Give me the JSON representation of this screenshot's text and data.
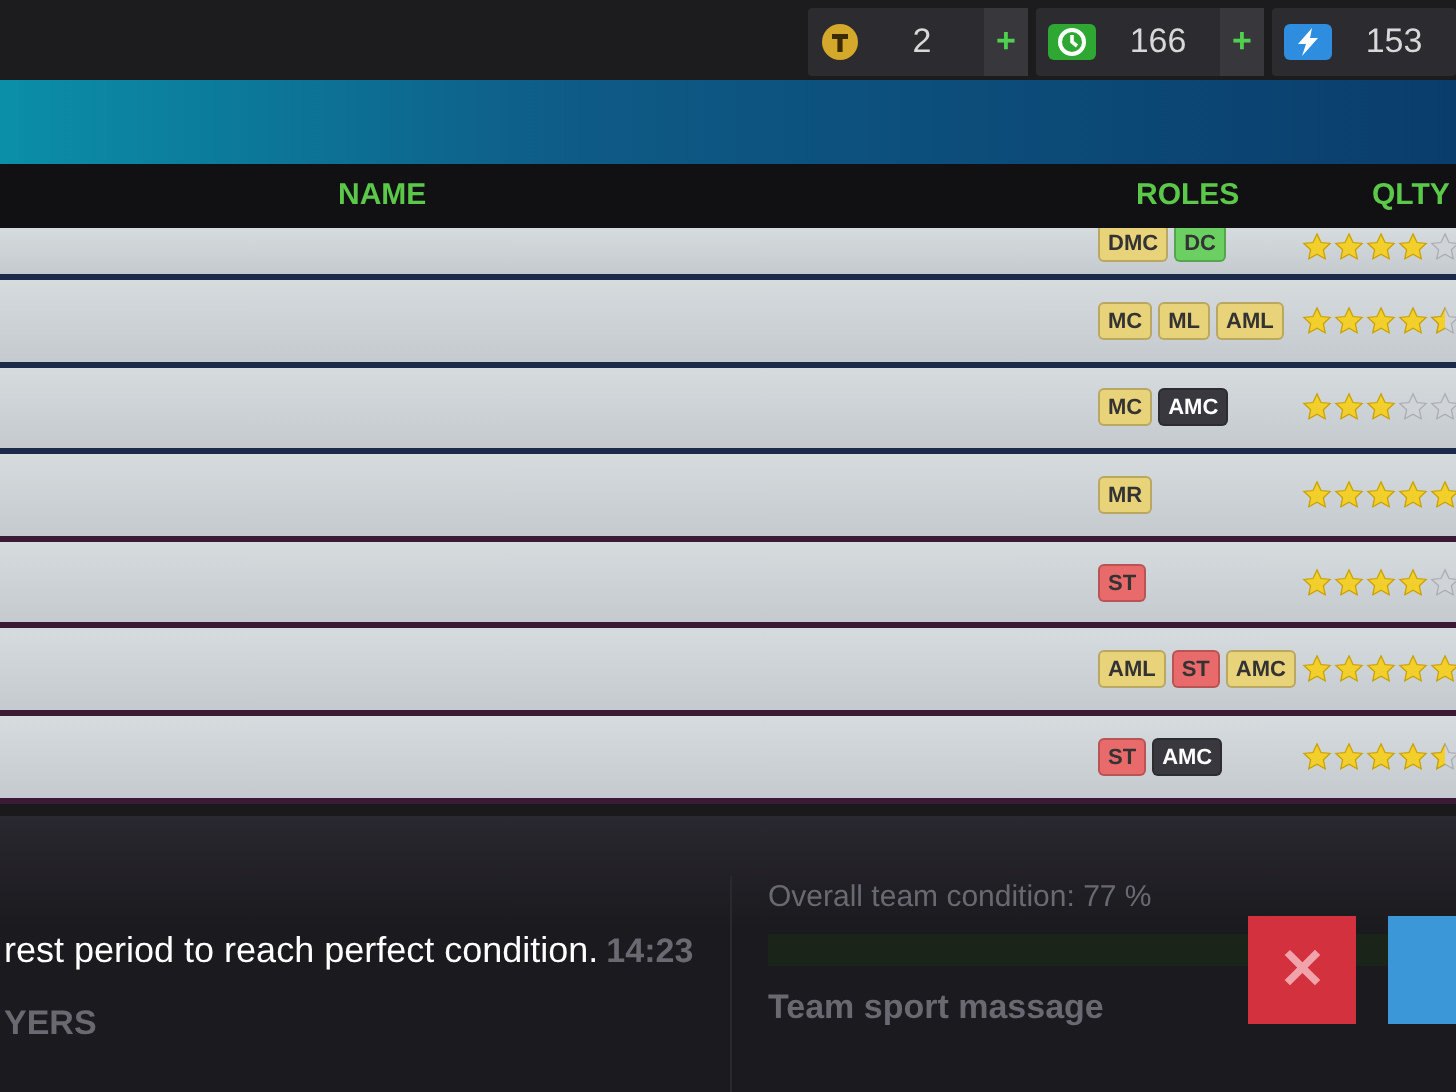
{
  "currencies": [
    {
      "kind": "coin",
      "amount": "2",
      "add": "+"
    },
    {
      "kind": "time",
      "amount": "166",
      "add": "+"
    },
    {
      "kind": "energy",
      "amount": "153"
    }
  ],
  "table": {
    "columns": [
      "NAME",
      "ROLES",
      "QLTY"
    ],
    "rows": [
      {
        "roles": [
          {
            "label": "DMC",
            "color": "#e8d27a"
          },
          {
            "label": "DC",
            "color": "#6ccf62"
          }
        ],
        "stars": 4
      },
      {
        "roles": [
          {
            "label": "MC",
            "color": "#e8d27a"
          },
          {
            "label": "ML",
            "color": "#e8d27a"
          },
          {
            "label": "AML",
            "color": "#e8d27a"
          }
        ],
        "stars": 4.5
      },
      {
        "roles": [
          {
            "label": "MC",
            "color": "#e8d27a"
          },
          {
            "label": "AMC",
            "color": "#38383e"
          }
        ],
        "stars": 3
      },
      {
        "roles": [
          {
            "label": "MR",
            "color": "#e8d27a"
          }
        ],
        "stars": 5
      },
      {
        "roles": [
          {
            "label": "ST",
            "color": "#e86a6a"
          }
        ],
        "stars": 4
      },
      {
        "roles": [
          {
            "label": "AML",
            "color": "#e8d27a"
          },
          {
            "label": "ST",
            "color": "#e86a6a"
          },
          {
            "label": "AMC",
            "color": "#e8d27a"
          }
        ],
        "stars": 5
      },
      {
        "roles": [
          {
            "label": "ST",
            "color": "#e86a6a"
          },
          {
            "label": "AMC",
            "color": "#38383e"
          }
        ],
        "stars": 4.5
      }
    ]
  },
  "rest_panel": {
    "message": "rest period to reach perfect condition.",
    "timer": "14:23",
    "players_label": "YERS"
  },
  "condition_panel": {
    "title": "Overall team condition: 77 %",
    "action": "Team sport massage"
  },
  "close_button": {
    "symbol": "✕"
  }
}
